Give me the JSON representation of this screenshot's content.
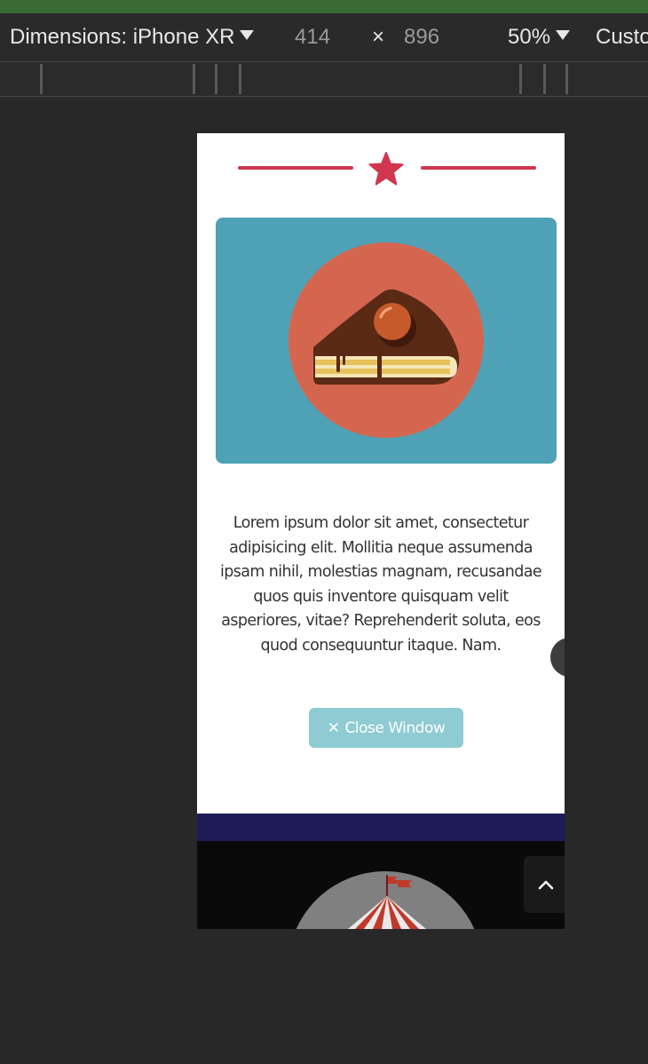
{
  "devtools": {
    "dimensions_label": "Dimensions: iPhone XR",
    "width": "414",
    "times": "×",
    "height": "896",
    "zoom": "50%",
    "custom": "Custo"
  },
  "page": {
    "hero_icon": "cake-slice-icon",
    "description": "Lorem ipsum dolor sit amet, consectetur adipisicing elit. Mollitia neque assumenda ipsam nihil, molestias magnam, recusandae quos quis inventore quisquam velit asperiores, vitae? Reprehenderit soluta, eos quod consequuntur itaque. Nam.",
    "close_button": {
      "icon": "✕",
      "label": "Close Window"
    },
    "scroll_top_icon": "chevron-up-icon",
    "portfolio_icon": "circus-tent-icon"
  },
  "colors": {
    "accent_red": "#d0364e",
    "hero_bg": "#4fa2b6",
    "button_bg": "#8fcbd2",
    "nav_band": "#1f1c58",
    "circle": "#d46650"
  }
}
